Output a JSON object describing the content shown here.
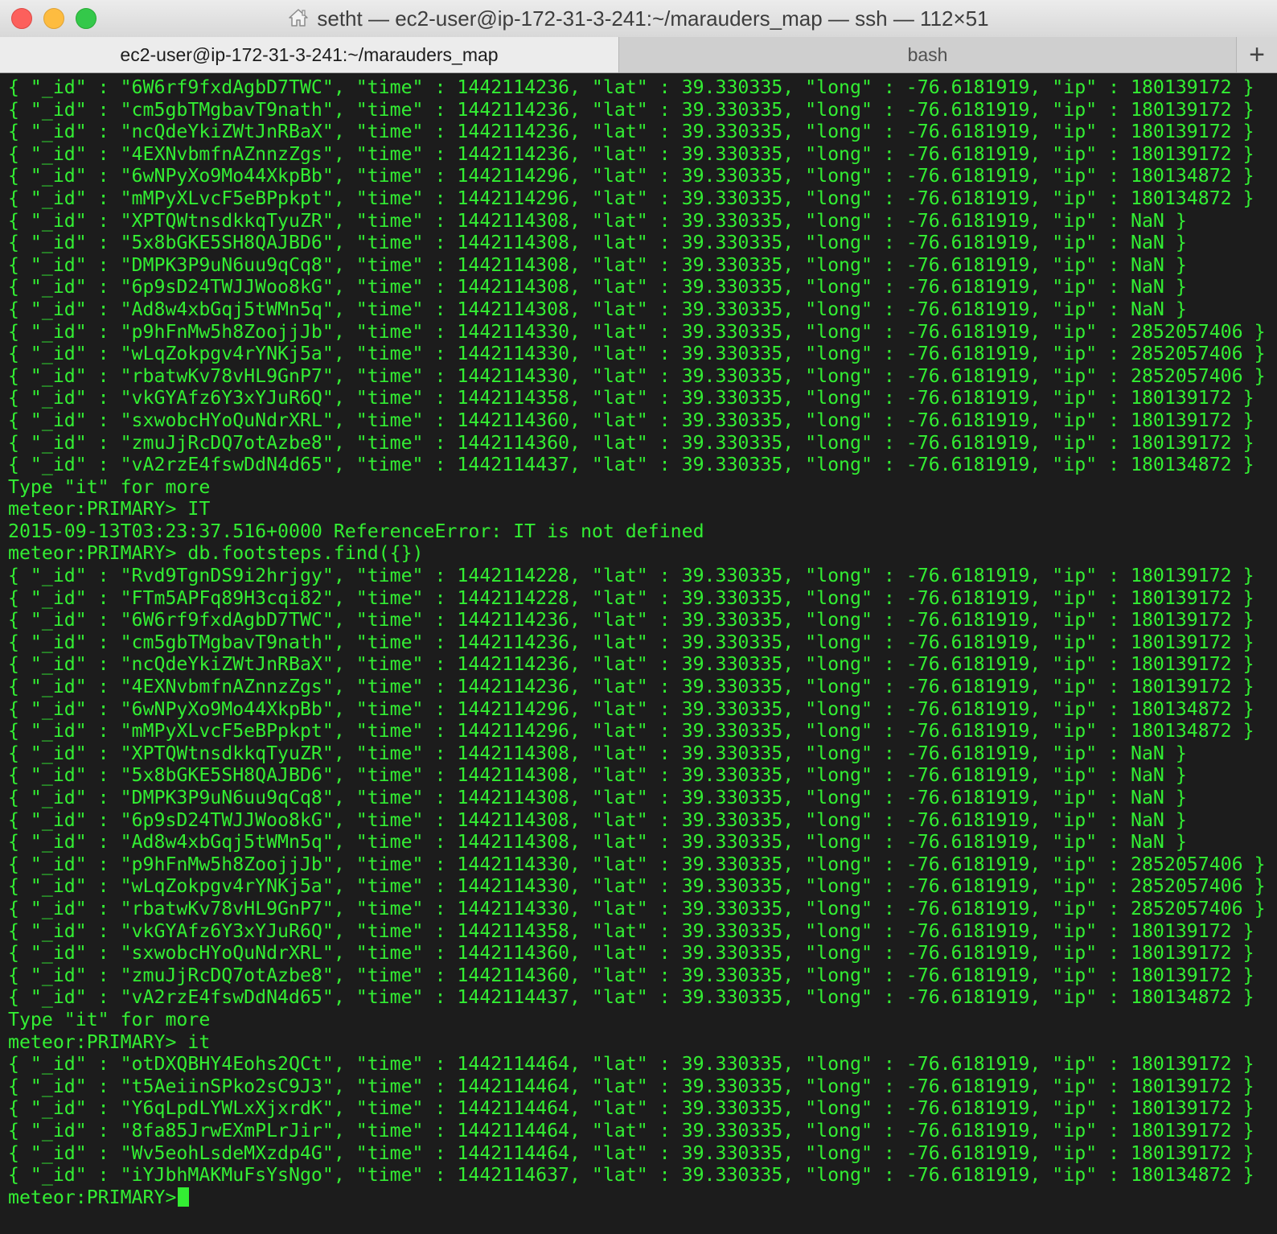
{
  "window": {
    "title": "setht — ec2-user@ip-172-31-3-241:~/marauders_map — ssh — 112×51",
    "home_icon": "home-icon"
  },
  "tabs": [
    {
      "label": "ec2-user@ip-172-31-3-241:~/marauders_map",
      "active": true
    },
    {
      "label": "bash",
      "active": false
    }
  ],
  "new_tab_label": "+",
  "terminal": {
    "text_color": "#33ee33",
    "background": "#1c1c1c",
    "lines": [
      "{ \"_id\" : \"6W6rf9fxdAgbD7TWC\", \"time\" : 1442114236, \"lat\" : 39.330335, \"long\" : -76.6181919, \"ip\" : 180139172 }",
      "{ \"_id\" : \"cm5gbTMgbavT9nath\", \"time\" : 1442114236, \"lat\" : 39.330335, \"long\" : -76.6181919, \"ip\" : 180139172 }",
      "{ \"_id\" : \"ncQdeYkiZWtJnRBaX\", \"time\" : 1442114236, \"lat\" : 39.330335, \"long\" : -76.6181919, \"ip\" : 180139172 }",
      "{ \"_id\" : \"4EXNvbmfnAZnnzZgs\", \"time\" : 1442114236, \"lat\" : 39.330335, \"long\" : -76.6181919, \"ip\" : 180139172 }",
      "{ \"_id\" : \"6wNPyXo9Mo44XkpBb\", \"time\" : 1442114296, \"lat\" : 39.330335, \"long\" : -76.6181919, \"ip\" : 180134872 }",
      "{ \"_id\" : \"mMPyXLvcF5eBPpkpt\", \"time\" : 1442114296, \"lat\" : 39.330335, \"long\" : -76.6181919, \"ip\" : 180134872 }",
      "{ \"_id\" : \"XPTQWtnsdkkqTyuZR\", \"time\" : 1442114308, \"lat\" : 39.330335, \"long\" : -76.6181919, \"ip\" : NaN }",
      "{ \"_id\" : \"5x8bGKE5SH8QAJBD6\", \"time\" : 1442114308, \"lat\" : 39.330335, \"long\" : -76.6181919, \"ip\" : NaN }",
      "{ \"_id\" : \"DMPK3P9uN6uu9qCq8\", \"time\" : 1442114308, \"lat\" : 39.330335, \"long\" : -76.6181919, \"ip\" : NaN }",
      "{ \"_id\" : \"6p9sD24TWJJWoo8kG\", \"time\" : 1442114308, \"lat\" : 39.330335, \"long\" : -76.6181919, \"ip\" : NaN }",
      "{ \"_id\" : \"Ad8w4xbGqj5tWMn5q\", \"time\" : 1442114308, \"lat\" : 39.330335, \"long\" : -76.6181919, \"ip\" : NaN }",
      "{ \"_id\" : \"p9hFnMw5h8ZoojjJb\", \"time\" : 1442114330, \"lat\" : 39.330335, \"long\" : -76.6181919, \"ip\" : 2852057406 }",
      "{ \"_id\" : \"wLqZokpgv4rYNKj5a\", \"time\" : 1442114330, \"lat\" : 39.330335, \"long\" : -76.6181919, \"ip\" : 2852057406 }",
      "{ \"_id\" : \"rbatwKv78vHL9GnP7\", \"time\" : 1442114330, \"lat\" : 39.330335, \"long\" : -76.6181919, \"ip\" : 2852057406 }",
      "{ \"_id\" : \"vkGYAfz6Y3xYJuR6Q\", \"time\" : 1442114358, \"lat\" : 39.330335, \"long\" : -76.6181919, \"ip\" : 180139172 }",
      "{ \"_id\" : \"sxwobcHYoQuNdrXRL\", \"time\" : 1442114360, \"lat\" : 39.330335, \"long\" : -76.6181919, \"ip\" : 180139172 }",
      "{ \"_id\" : \"zmuJjRcDQ7otAzbe8\", \"time\" : 1442114360, \"lat\" : 39.330335, \"long\" : -76.6181919, \"ip\" : 180139172 }",
      "{ \"_id\" : \"vA2rzE4fswDdN4d65\", \"time\" : 1442114437, \"lat\" : 39.330335, \"long\" : -76.6181919, \"ip\" : 180134872 }",
      "Type \"it\" for more",
      "meteor:PRIMARY> IT",
      "2015-09-13T03:23:37.516+0000 ReferenceError: IT is not defined",
      "meteor:PRIMARY> db.footsteps.find({})",
      "{ \"_id\" : \"Rvd9TgnDS9i2hrjgy\", \"time\" : 1442114228, \"lat\" : 39.330335, \"long\" : -76.6181919, \"ip\" : 180139172 }",
      "{ \"_id\" : \"FTm5APFq89H3cqi82\", \"time\" : 1442114228, \"lat\" : 39.330335, \"long\" : -76.6181919, \"ip\" : 180139172 }",
      "{ \"_id\" : \"6W6rf9fxdAgbD7TWC\", \"time\" : 1442114236, \"lat\" : 39.330335, \"long\" : -76.6181919, \"ip\" : 180139172 }",
      "{ \"_id\" : \"cm5gbTMgbavT9nath\", \"time\" : 1442114236, \"lat\" : 39.330335, \"long\" : -76.6181919, \"ip\" : 180139172 }",
      "{ \"_id\" : \"ncQdeYkiZWtJnRBaX\", \"time\" : 1442114236, \"lat\" : 39.330335, \"long\" : -76.6181919, \"ip\" : 180139172 }",
      "{ \"_id\" : \"4EXNvbmfnAZnnzZgs\", \"time\" : 1442114236, \"lat\" : 39.330335, \"long\" : -76.6181919, \"ip\" : 180139172 }",
      "{ \"_id\" : \"6wNPyXo9Mo44XkpBb\", \"time\" : 1442114296, \"lat\" : 39.330335, \"long\" : -76.6181919, \"ip\" : 180134872 }",
      "{ \"_id\" : \"mMPyXLvcF5eBPpkpt\", \"time\" : 1442114296, \"lat\" : 39.330335, \"long\" : -76.6181919, \"ip\" : 180134872 }",
      "{ \"_id\" : \"XPTQWtnsdkkqTyuZR\", \"time\" : 1442114308, \"lat\" : 39.330335, \"long\" : -76.6181919, \"ip\" : NaN }",
      "{ \"_id\" : \"5x8bGKE5SH8QAJBD6\", \"time\" : 1442114308, \"lat\" : 39.330335, \"long\" : -76.6181919, \"ip\" : NaN }",
      "{ \"_id\" : \"DMPK3P9uN6uu9qCq8\", \"time\" : 1442114308, \"lat\" : 39.330335, \"long\" : -76.6181919, \"ip\" : NaN }",
      "{ \"_id\" : \"6p9sD24TWJJWoo8kG\", \"time\" : 1442114308, \"lat\" : 39.330335, \"long\" : -76.6181919, \"ip\" : NaN }",
      "{ \"_id\" : \"Ad8w4xbGqj5tWMn5q\", \"time\" : 1442114308, \"lat\" : 39.330335, \"long\" : -76.6181919, \"ip\" : NaN }",
      "{ \"_id\" : \"p9hFnMw5h8ZoojjJb\", \"time\" : 1442114330, \"lat\" : 39.330335, \"long\" : -76.6181919, \"ip\" : 2852057406 }",
      "{ \"_id\" : \"wLqZokpgv4rYNKj5a\", \"time\" : 1442114330, \"lat\" : 39.330335, \"long\" : -76.6181919, \"ip\" : 2852057406 }",
      "{ \"_id\" : \"rbatwKv78vHL9GnP7\", \"time\" : 1442114330, \"lat\" : 39.330335, \"long\" : -76.6181919, \"ip\" : 2852057406 }",
      "{ \"_id\" : \"vkGYAfz6Y3xYJuR6Q\", \"time\" : 1442114358, \"lat\" : 39.330335, \"long\" : -76.6181919, \"ip\" : 180139172 }",
      "{ \"_id\" : \"sxwobcHYoQuNdrXRL\", \"time\" : 1442114360, \"lat\" : 39.330335, \"long\" : -76.6181919, \"ip\" : 180139172 }",
      "{ \"_id\" : \"zmuJjRcDQ7otAzbe8\", \"time\" : 1442114360, \"lat\" : 39.330335, \"long\" : -76.6181919, \"ip\" : 180139172 }",
      "{ \"_id\" : \"vA2rzE4fswDdN4d65\", \"time\" : 1442114437, \"lat\" : 39.330335, \"long\" : -76.6181919, \"ip\" : 180134872 }",
      "Type \"it\" for more",
      "meteor:PRIMARY> it",
      "{ \"_id\" : \"otDXQBHY4Eohs2QCt\", \"time\" : 1442114464, \"lat\" : 39.330335, \"long\" : -76.6181919, \"ip\" : 180139172 }",
      "{ \"_id\" : \"t5AeiinSPko2sC9J3\", \"time\" : 1442114464, \"lat\" : 39.330335, \"long\" : -76.6181919, \"ip\" : 180139172 }",
      "{ \"_id\" : \"Y6qLpdLYWLxXjxrdK\", \"time\" : 1442114464, \"lat\" : 39.330335, \"long\" : -76.6181919, \"ip\" : 180139172 }",
      "{ \"_id\" : \"8fa85JrwEXmPLrJir\", \"time\" : 1442114464, \"lat\" : 39.330335, \"long\" : -76.6181919, \"ip\" : 180139172 }",
      "{ \"_id\" : \"Wv5eohLsdeMXzdp4G\", \"time\" : 1442114464, \"lat\" : 39.330335, \"long\" : -76.6181919, \"ip\" : 180139172 }",
      "{ \"_id\" : \"iYJbhMAKMuFsYsNgo\", \"time\" : 1442114637, \"lat\" : 39.330335, \"long\" : -76.6181919, \"ip\" : 180134872 }"
    ],
    "prompt": "meteor:PRIMARY>"
  }
}
